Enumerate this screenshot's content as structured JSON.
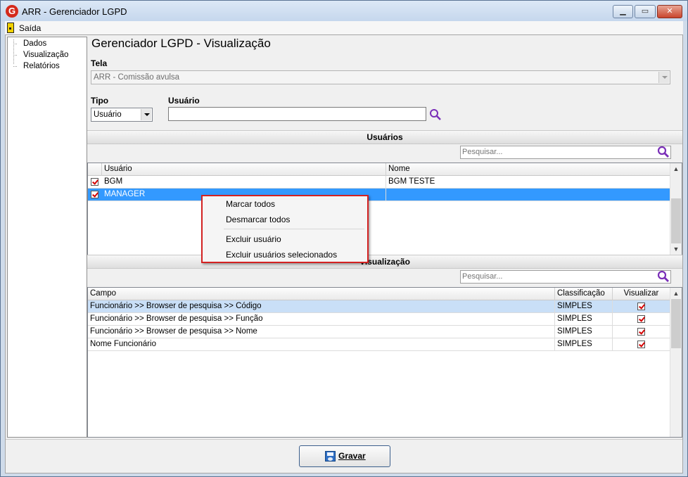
{
  "window": {
    "title": "ARR - Gerenciador LGPD",
    "logo_letter": "G",
    "minimize": "▁",
    "maximize": "▭",
    "close": "✕"
  },
  "menu": {
    "exit_label": "Saída"
  },
  "nav": {
    "items": [
      "Dados",
      "Visualização",
      "Relatórios"
    ]
  },
  "page_title": "Gerenciador LGPD - Visualização",
  "form": {
    "tela_label": "Tela",
    "tela_value": "ARR - Comissão avulsa",
    "tipo_label": "Tipo",
    "tipo_value": "Usuário",
    "usuario_label": "Usuário",
    "usuario_value": ""
  },
  "usuarios_section": {
    "title": "Usuários",
    "search_placeholder": "Pesquisar...",
    "columns": [
      "Usuário",
      "Nome"
    ],
    "rows": [
      {
        "usuario": "BGM",
        "nome": "BGM TESTE",
        "checked": true
      },
      {
        "usuario": "MANAGER",
        "nome": "",
        "checked": true
      }
    ]
  },
  "visualizacao_section": {
    "title": "Visualização",
    "search_placeholder": "Pesquisar...",
    "columns": [
      "Campo",
      "Classificação",
      "Visualizar"
    ],
    "rows": [
      {
        "campo": "Funcionário >> Browser de pesquisa >> Código",
        "classificacao": "SIMPLES",
        "visualizar": true
      },
      {
        "campo": "Funcionário >> Browser de pesquisa >> Função",
        "classificacao": "SIMPLES",
        "visualizar": true
      },
      {
        "campo": "Funcionário >> Browser de pesquisa >> Nome",
        "classificacao": "SIMPLES",
        "visualizar": true
      },
      {
        "campo": "Nome Funcionário",
        "classificacao": "SIMPLES",
        "visualizar": true
      }
    ]
  },
  "context_menu": {
    "items": [
      "Marcar todos",
      "Desmarcar todos",
      "Excluir usuário",
      "Excluir usuários selecionados"
    ]
  },
  "footer": {
    "save_label": "Gravar"
  },
  "colors": {
    "accent_red": "#d32222",
    "selection_blue": "#3399ff",
    "search_icon": "#7a2fb8"
  },
  "icons": [
    "app-logo-icon",
    "exit-door-icon",
    "search-icon",
    "save-disk-icon",
    "checkbox-icon",
    "chevron-up-icon",
    "chevron-down-icon"
  ]
}
